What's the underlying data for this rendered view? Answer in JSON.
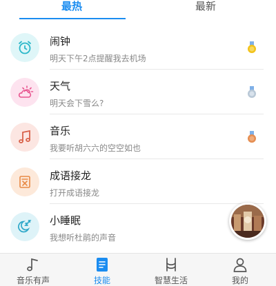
{
  "tabs": {
    "hot": "最热",
    "new": "最新"
  },
  "skills": [
    {
      "title": "闹钟",
      "subtitle": "明天下午2点提醒我去机场",
      "icon": "alarm-clock-icon",
      "icon_bg": "#dff6f8",
      "icon_color": "#2bb7c9",
      "medal": "gold"
    },
    {
      "title": "天气",
      "subtitle": "明天会下雪么?",
      "icon": "weather-sun-cloud-icon",
      "icon_bg": "#fde3ef",
      "icon_color": "#e8558f",
      "medal": "silver"
    },
    {
      "title": "音乐",
      "subtitle": "我要听胡六六的空空如也",
      "icon": "music-note-icon",
      "icon_bg": "#fce6e2",
      "icon_color": "#d8624a",
      "medal": "bronze"
    },
    {
      "title": "成语接龙",
      "subtitle": "打开成语接龙",
      "icon": "idiom-book-icon",
      "icon_bg": "#fde9da",
      "icon_color": "#e88a45",
      "medal": ""
    },
    {
      "title": "小睡眠",
      "subtitle": "我想听杜鹃的声音",
      "icon": "sleep-moon-icon",
      "icon_bg": "#def3f8",
      "icon_color": "#2fa8c9",
      "medal": ""
    }
  ],
  "bottom_nav": [
    {
      "label": "音乐有声",
      "icon": "music-note-icon",
      "active": false
    },
    {
      "label": "技能",
      "icon": "skills-book-icon",
      "active": true
    },
    {
      "label": "智慧生活",
      "icon": "smart-life-icon",
      "active": false
    },
    {
      "label": "我的",
      "icon": "user-profile-icon",
      "active": false
    }
  ],
  "colors": {
    "accent": "#1a8cf0",
    "gold": "#f2c21b",
    "silver": "#b9c8d6",
    "bronze": "#e58e52"
  }
}
